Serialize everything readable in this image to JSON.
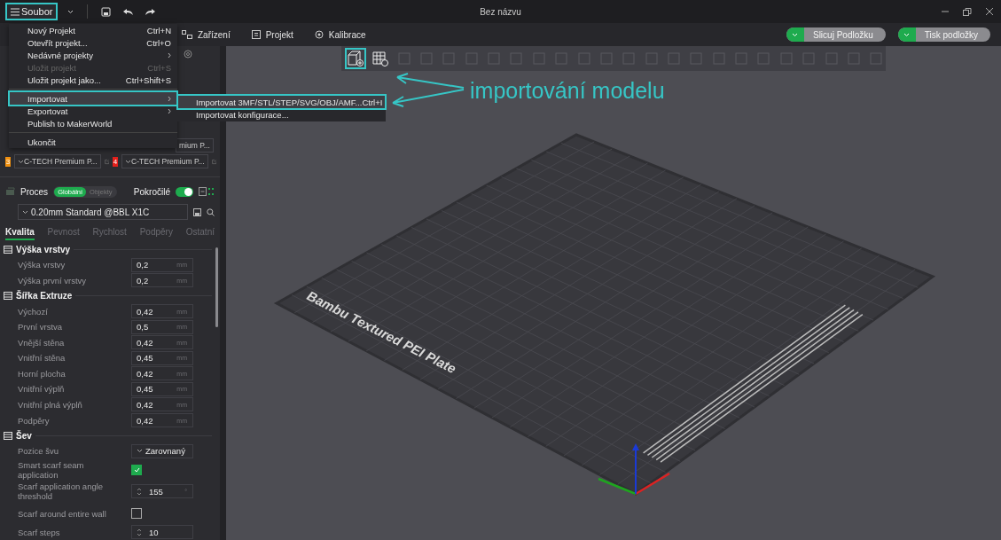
{
  "window": {
    "title": "Bez názvu"
  },
  "file_menu_button": {
    "label": "Soubor",
    "selected": true
  },
  "file_menu": [
    {
      "kind": "item",
      "label": "Nový Projekt",
      "shortcut": "Ctrl+N",
      "disabled": false,
      "selected": false
    },
    {
      "kind": "item",
      "label": "Otevřít projekt...",
      "shortcut": "Ctrl+O",
      "disabled": false,
      "selected": false
    },
    {
      "kind": "submenu",
      "label": "Nedávné projekty",
      "disabled": false,
      "selected": false
    },
    {
      "kind": "item",
      "label": "Uložit projekt",
      "shortcut": "Ctrl+S",
      "disabled": true,
      "selected": false
    },
    {
      "kind": "item",
      "label": "Uložit projekt jako...",
      "shortcut": "Ctrl+Shift+S",
      "disabled": false,
      "selected": false
    },
    {
      "kind": "separator"
    },
    {
      "kind": "submenu",
      "label": "Importovat",
      "disabled": false,
      "selected": true
    },
    {
      "kind": "submenu",
      "label": "Exportovat",
      "disabled": false,
      "selected": false
    },
    {
      "kind": "item",
      "label": "Publish to MakerWorld",
      "disabled": false,
      "selected": false
    },
    {
      "kind": "separator"
    },
    {
      "kind": "item",
      "label": "Ukončit",
      "disabled": false,
      "selected": false
    }
  ],
  "import_submenu": [
    {
      "label": "Importovat 3MF/STL/STEP/SVG/OBJ/AMF...",
      "shortcut": "Ctrl+I",
      "selected": true
    },
    {
      "label": "Importovat konfigurace...",
      "selected": false
    }
  ],
  "top_tabs": [
    {
      "label": "Zařízení"
    },
    {
      "label": "Projekt"
    },
    {
      "label": "Kalibrace"
    }
  ],
  "actions": [
    {
      "label": "Slicuj Podložku"
    },
    {
      "label": "Tisk podložky"
    }
  ],
  "filaments": {
    "partial_name": "mium P...",
    "items": [
      {
        "number": "3",
        "color": "#f0900f",
        "name": "C-TECH Premium P..."
      },
      {
        "number": "4",
        "color": "#e3201b",
        "name": "C-TECH Premium P..."
      }
    ]
  },
  "process": {
    "title": "Proces",
    "scope": [
      {
        "label": "Globální",
        "selected": true
      },
      {
        "label": "Objekty",
        "selected": false
      }
    ],
    "advanced": {
      "label": "Pokročilé",
      "on": true
    },
    "preset": "0.20mm Standard @BBL X1C"
  },
  "settings_tabs": [
    {
      "label": "Kvalita",
      "selected": true
    },
    {
      "label": "Pevnost",
      "selected": false
    },
    {
      "label": "Rychlost",
      "selected": false
    },
    {
      "label": "Podpěry",
      "selected": false
    },
    {
      "label": "Ostatní",
      "selected": false
    }
  ],
  "sections": [
    {
      "title": "Výška vrstvy",
      "rows": [
        {
          "kind": "value",
          "label": "Výška vrstvy",
          "value": "0,2",
          "unit": "mm"
        },
        {
          "kind": "value",
          "label": "Výška první vrstvy",
          "value": "0,2",
          "unit": "mm"
        }
      ]
    },
    {
      "title": "Šířka Extruze",
      "rows": [
        {
          "kind": "value",
          "label": "Výchozí",
          "value": "0,42",
          "unit": "mm"
        },
        {
          "kind": "value",
          "label": "První vrstva",
          "value": "0,5",
          "unit": "mm"
        },
        {
          "kind": "value",
          "label": "Vnější stěna",
          "value": "0,42",
          "unit": "mm"
        },
        {
          "kind": "value",
          "label": "Vnitřní stěna",
          "value": "0,45",
          "unit": "mm"
        },
        {
          "kind": "value",
          "label": "Horní plocha",
          "value": "0,42",
          "unit": "mm"
        },
        {
          "kind": "value",
          "label": "Vnitřní výplň",
          "value": "0,45",
          "unit": "mm"
        },
        {
          "kind": "value",
          "label": "Vnitřní plná výplň",
          "value": "0,42",
          "unit": "mm"
        },
        {
          "kind": "value",
          "label": "Podpěry",
          "value": "0,42",
          "unit": "mm"
        }
      ]
    },
    {
      "title": "Šev",
      "rows": [
        {
          "kind": "select",
          "label": "Pozice švu",
          "value": "Zarovnaný"
        },
        {
          "kind": "checkbox",
          "label": "Smart scarf seam application",
          "checked": true
        },
        {
          "kind": "spinner",
          "label": "Scarf application angle threshold",
          "value": "155",
          "unit": "°"
        },
        {
          "kind": "checkbox",
          "label": "Scarf around entire wall",
          "checked": false
        },
        {
          "kind": "spinner",
          "label": "Scarf steps",
          "value": "10"
        }
      ]
    }
  ],
  "annotation": {
    "text": "importování modelu"
  },
  "plate": {
    "label": "Bambu Textured PEI Plate"
  }
}
